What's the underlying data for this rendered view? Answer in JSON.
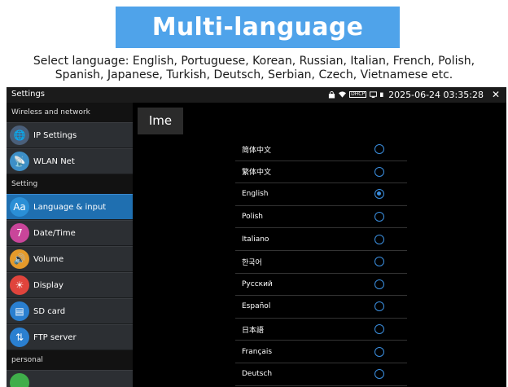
{
  "banner": {
    "title": "Multi-language"
  },
  "subtitle": {
    "line1": "Select language: English, Portuguese, Korean, Russian, Italian, French, Polish,",
    "line2": "Spanish, Japanese, Turkish, Deutsch, Serbian, Czech, Vietnamese etc."
  },
  "topbar": {
    "title": "Settings",
    "dhcp": "DHCP",
    "datetime": "2025-06-24 03:35:28",
    "close": "✕"
  },
  "sidebar": {
    "sections": [
      {
        "header": "Wireless and network",
        "items": [
          {
            "label": "IP Settings",
            "icon": "globe-icon",
            "glyph": "🌐",
            "color": "#4a5f7a"
          },
          {
            "label": "WLAN Net",
            "icon": "wifi-antenna-icon",
            "glyph": "📡",
            "color": "#3d8fc7"
          }
        ]
      },
      {
        "header": "Setting",
        "items": [
          {
            "label": "Language & input",
            "icon": "language-icon",
            "glyph": "Aa",
            "color": "#2a8fd6",
            "active": true
          },
          {
            "label": "Date/Time",
            "icon": "calendar-icon",
            "glyph": "7",
            "color": "#c9459a"
          },
          {
            "label": "Volume",
            "icon": "volume-icon",
            "glyph": "🔊",
            "color": "#e59a2a"
          },
          {
            "label": "Display",
            "icon": "display-icon",
            "glyph": "☀",
            "color": "#e0443c"
          },
          {
            "label": "SD card",
            "icon": "sd-card-icon",
            "glyph": "▤",
            "color": "#2a7fd0"
          },
          {
            "label": "FTP server",
            "icon": "ftp-server-icon",
            "glyph": "⇅",
            "color": "#2a7fd0"
          }
        ]
      },
      {
        "header": "personal",
        "items": []
      }
    ]
  },
  "content": {
    "ime_label": "Ime",
    "languages": [
      {
        "name": "简体中文",
        "selected": false
      },
      {
        "name": "繁体中文",
        "selected": false
      },
      {
        "name": "English",
        "selected": true
      },
      {
        "name": "Polish",
        "selected": false
      },
      {
        "name": "Italiano",
        "selected": false
      },
      {
        "name": "한국어",
        "selected": false
      },
      {
        "name": "Русский",
        "selected": false
      },
      {
        "name": "Español",
        "selected": false
      },
      {
        "name": "日本語",
        "selected": false
      },
      {
        "name": "Français",
        "selected": false
      },
      {
        "name": "Deutsch",
        "selected": false
      }
    ]
  },
  "colors": {
    "accent": "#4fa3ea",
    "radio": "#3b8fe0",
    "active_item": "#1f6fb0"
  }
}
